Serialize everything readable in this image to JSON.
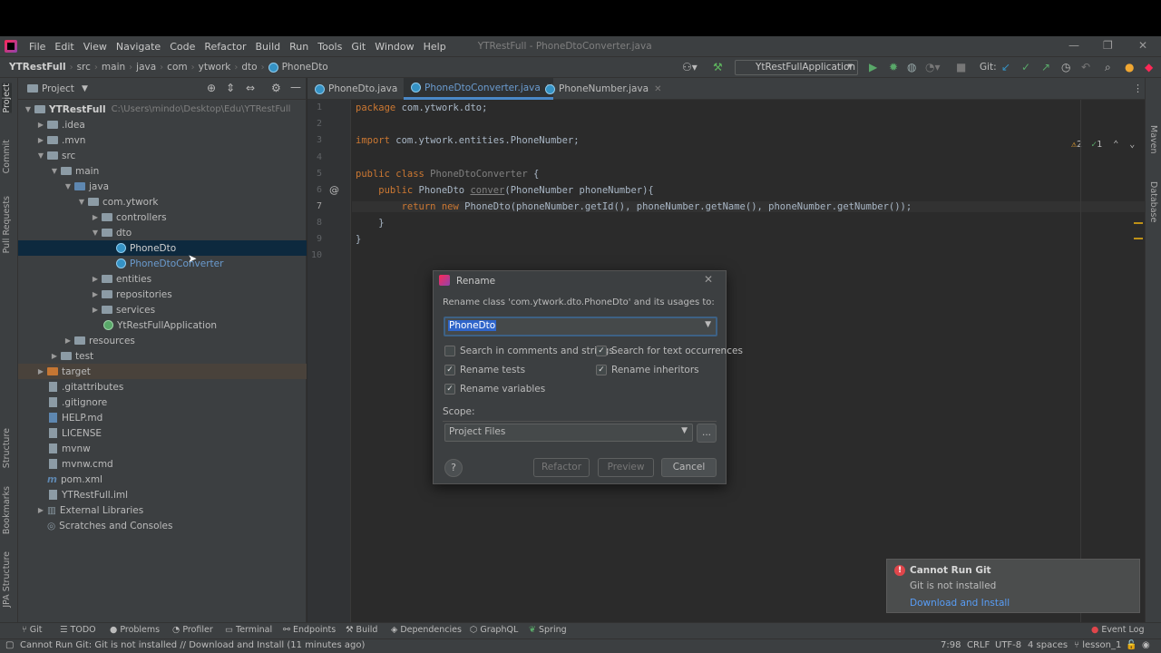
{
  "window": {
    "title": "YTRestFull - PhoneDtoConverter.java"
  },
  "menu": [
    "File",
    "Edit",
    "View",
    "Navigate",
    "Code",
    "Refactor",
    "Build",
    "Run",
    "Tools",
    "Git",
    "Window",
    "Help"
  ],
  "breadcrumbs": [
    "YTRestFull",
    "src",
    "main",
    "java",
    "com",
    "ytwork",
    "dto",
    "PhoneDto"
  ],
  "toolbar": {
    "run_config": "YtRestFullApplication",
    "git_label": "Git:"
  },
  "project_panel": {
    "title": "Project",
    "root": "YTRestFull",
    "root_path": "C:\\Users\\mindo\\Desktop\\Edu\\YTRestFull",
    "tree": [
      ".idea",
      ".mvn",
      "src",
      "main",
      "java",
      "com.ytwork",
      "controllers",
      "dto",
      "PhoneDto",
      "PhoneDtoConverter",
      "entities",
      "repositories",
      "services",
      "YtRestFullApplication",
      "resources",
      "test",
      "target",
      ".gitattributes",
      ".gitignore",
      "HELP.md",
      "LICENSE",
      "mvnw",
      "mvnw.cmd",
      "pom.xml",
      "YTRestFull.iml",
      "External Libraries",
      "Scratches and Consoles"
    ]
  },
  "tabs": [
    "PhoneDto.java",
    "PhoneDtoConverter.java",
    "PhoneNumber.java"
  ],
  "editor": {
    "line_numbers": [
      "1",
      "2",
      "3",
      "4",
      "5",
      "6",
      "7",
      "8",
      "9",
      "10"
    ],
    "code": {
      "l1_kw": "package",
      "l1_rest": " com.ytwork.dto;",
      "l3_kw": "import",
      "l3_rest": " com.ytwork.entities.PhoneNumber;",
      "l5_kw": "public class",
      "l5_name": " PhoneDtoConverter",
      "l5_rest": " {",
      "l6_kw": "    public",
      "l6_type": " PhoneDto ",
      "l6_method": "conver",
      "l6_rest": "(PhoneNumber phoneNumber){",
      "l7_kw": "        return new",
      "l7_rest": " PhoneDto(phoneNumber.getId(), phoneNumber.getName(), phoneNumber.getNumber());",
      "l8": "    }",
      "l9": "}"
    },
    "inspections": {
      "warnings": "2",
      "ok": "1"
    }
  },
  "side_tools_left": [
    "Project",
    "Commit",
    "Pull Requests",
    "Structure",
    "Bookmarks",
    "JPA Structure"
  ],
  "side_tools_right": [
    "Maven",
    "Database"
  ],
  "dialog": {
    "title": "Rename",
    "prompt": "Rename class 'com.ytwork.dto.PhoneDto' and its usages to:",
    "name_value": "PhoneDto",
    "options": [
      {
        "label": "Search in comments and strings",
        "checked": false
      },
      {
        "label": "Search for text occurrences",
        "checked": true
      },
      {
        "label": "Rename tests",
        "checked": true
      },
      {
        "label": "Rename inheritors",
        "checked": true
      },
      {
        "label": "Rename variables",
        "checked": true
      }
    ],
    "scope_label": "Scope:",
    "scope_value": "Project Files",
    "browse": "...",
    "help": "?",
    "buttons": {
      "refactor": "Refactor",
      "preview": "Preview",
      "cancel": "Cancel"
    }
  },
  "notification": {
    "title": "Cannot Run Git",
    "message": "Git is not installed",
    "action": "Download and Install"
  },
  "tool_windows": [
    "Git",
    "TODO",
    "Problems",
    "Profiler",
    "Terminal",
    "Endpoints",
    "Build",
    "Dependencies",
    "GraphQL",
    "Spring",
    "Event Log"
  ],
  "status_bar": {
    "message": "Cannot Run Git: Git is not installed // Download and Install (11 minutes ago)",
    "position": "7:98",
    "line_sep": "CRLF",
    "encoding": "UTF-8",
    "indent": "4 spaces",
    "branch": "lesson_1"
  },
  "colors": {
    "accent": "#4a88c7",
    "selection": "#0d293e",
    "error": "#e0464b",
    "link": "#589df6"
  }
}
